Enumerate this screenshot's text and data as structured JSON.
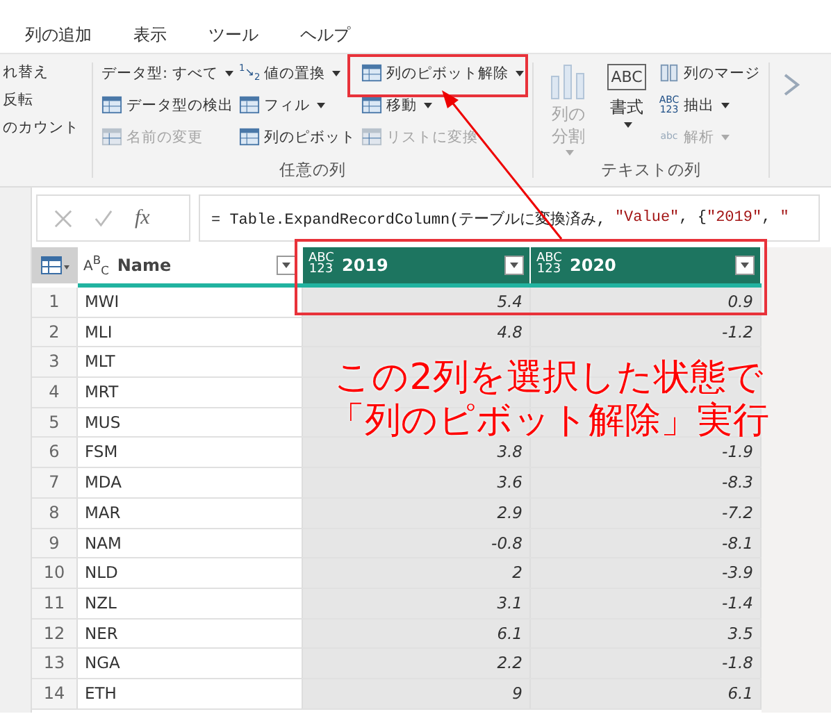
{
  "menu": [
    {
      "label": "列の追加"
    },
    {
      "label": "表示"
    },
    {
      "label": "ツール"
    },
    {
      "label": "ヘルプ"
    }
  ],
  "ribbon": {
    "cut_group": [
      {
        "label": "れ替え"
      },
      {
        "label": "反転"
      },
      {
        "label": "のカウント"
      }
    ],
    "any_column": {
      "label": "任意の列",
      "columns": [
        [
          {
            "label": "データ型: すべて",
            "dropdown": true,
            "disabled": false
          },
          {
            "label": "データ型の検出",
            "dropdown": false,
            "disabled": false
          },
          {
            "label": "名前の変更",
            "dropdown": false,
            "disabled": true
          }
        ],
        [
          {
            "label": "値の置換",
            "icon_text": "$^{1}$↘$_{2}$",
            "dropdown": true,
            "disabled": false
          },
          {
            "label": "フィル",
            "dropdown": true,
            "disabled": false
          },
          {
            "label": "列のピボット",
            "dropdown": false,
            "disabled": false
          }
        ],
        [
          {
            "label": "列のピボット解除",
            "dropdown": true,
            "disabled": false
          },
          {
            "label": "移動",
            "dropdown": true,
            "disabled": false
          },
          {
            "label": "リストに変換",
            "dropdown": false,
            "disabled": true
          }
        ]
      ]
    },
    "text_column": {
      "label": "テキストの列",
      "large": [
        {
          "label": "列の分割",
          "dropdown": true,
          "disabled": true
        },
        {
          "label": "書式",
          "icon_text": "ABC",
          "dropdown": true,
          "disabled": false
        }
      ],
      "small": [
        {
          "label": "列のマージ",
          "dropdown": false,
          "disabled": false
        },
        {
          "label": "抽出",
          "icon_text": "ABC 123",
          "dropdown": true,
          "disabled": false
        },
        {
          "label": "解析",
          "icon_text": "abc",
          "dropdown": true,
          "disabled": true
        }
      ]
    }
  },
  "function_label": "fx",
  "formula": [
    {
      "kind": "code",
      "text": "= Table.ExpandRecordColumn(テーブルに変換済み, "
    },
    {
      "kind": "string",
      "text": "\"Value\""
    },
    {
      "kind": "code",
      "text": ", {"
    },
    {
      "kind": "string",
      "text": "\"2019\""
    },
    {
      "kind": "code",
      "text": ", "
    },
    {
      "kind": "string",
      "text": "\""
    }
  ],
  "table": {
    "columns": [
      {
        "title": "Name",
        "type_icon": "A$^{B}$$_{C}$",
        "selected": false
      },
      {
        "title": "2019",
        "type_icon": "ABC 123",
        "selected": true
      },
      {
        "title": "2020",
        "type_icon": "ABC 123",
        "selected": true
      }
    ],
    "rows": [
      {
        "index": "1",
        "cells": [
          "MWI",
          "5.4",
          "0.9"
        ]
      },
      {
        "index": "2",
        "cells": [
          "MLI",
          "4.8",
          "-1.2"
        ]
      },
      {
        "index": "3",
        "cells": [
          "MLT",
          null,
          null
        ]
      },
      {
        "index": "4",
        "cells": [
          "MRT",
          null,
          null
        ]
      },
      {
        "index": "5",
        "cells": [
          "MUS",
          null,
          null
        ]
      },
      {
        "index": "6",
        "cells": [
          "FSM",
          "3.8",
          "-1.9"
        ]
      },
      {
        "index": "7",
        "cells": [
          "MDA",
          "3.6",
          "-8.3"
        ]
      },
      {
        "index": "8",
        "cells": [
          "MAR",
          "2.9",
          "-7.2"
        ]
      },
      {
        "index": "9",
        "cells": [
          "NAM",
          "-0.8",
          "-8.1"
        ]
      },
      {
        "index": "10",
        "cells": [
          "NLD",
          "2",
          "-3.9"
        ]
      },
      {
        "index": "11",
        "cells": [
          "NZL",
          "3.1",
          "-1.4"
        ]
      },
      {
        "index": "12",
        "cells": [
          "NER",
          "6.1",
          "3.5"
        ]
      },
      {
        "index": "13",
        "cells": [
          "NGA",
          "2.2",
          "-1.8"
        ]
      },
      {
        "index": "14",
        "cells": [
          "ETH",
          "9",
          "6.1"
        ]
      }
    ]
  },
  "annotation": {
    "lines": [
      "この2列を選択した状態で",
      "「列のピボット解除」実行"
    ]
  }
}
